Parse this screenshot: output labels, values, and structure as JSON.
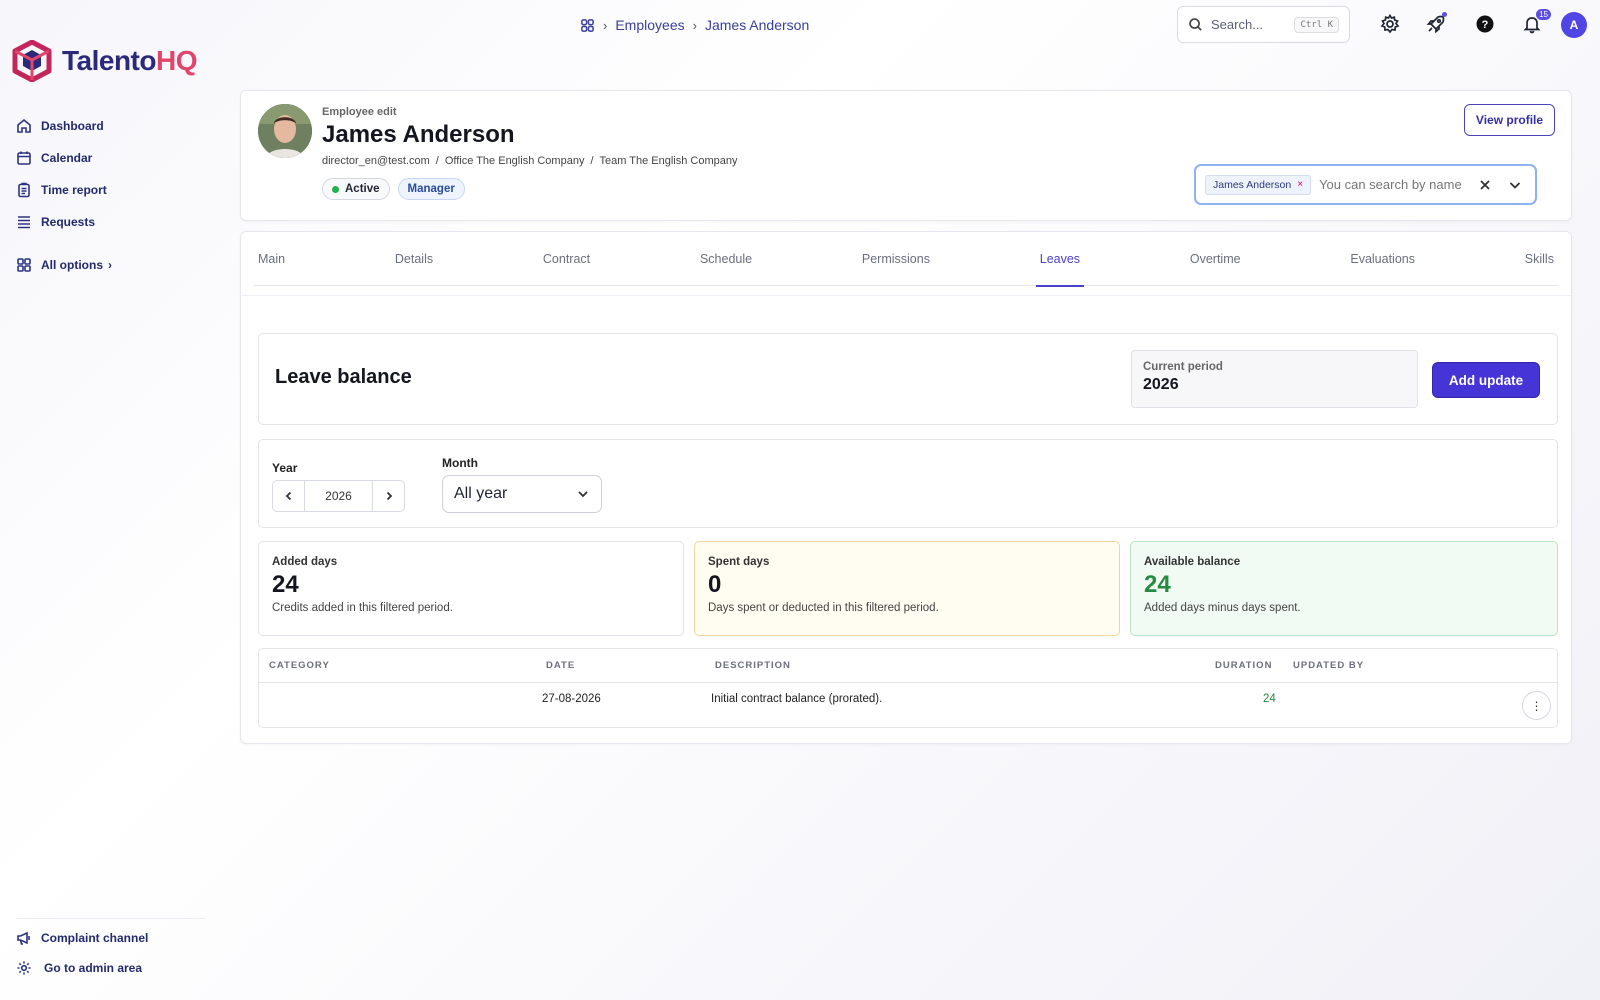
{
  "app": {
    "logo_part1": "Talento",
    "logo_part2": "HQ",
    "brand_colors": {
      "primary": "#2b2a7a",
      "accent": "#e2456b",
      "button": "#4635d6"
    }
  },
  "sidebar": {
    "items": [
      {
        "label": "Dashboard",
        "icon": "home-icon"
      },
      {
        "label": "Calendar",
        "icon": "calendar-icon"
      },
      {
        "label": "Time report",
        "icon": "clipboard-icon"
      },
      {
        "label": "Requests",
        "icon": "list-icon"
      }
    ],
    "all_options": "All options",
    "bottom": [
      {
        "label": "Complaint channel",
        "icon": "megaphone-icon"
      },
      {
        "label": "Go to admin area",
        "icon": "gear-icon"
      }
    ]
  },
  "breadcrumb": {
    "items": [
      "Employees",
      "James Anderson"
    ]
  },
  "topbar": {
    "search_placeholder": "Search...",
    "search_shortcut": "Ctrl K",
    "notification_count": "15",
    "avatar_initial": "A"
  },
  "employee": {
    "kicker": "Employee edit",
    "name": "James Anderson",
    "email": "director_en@test.com",
    "office": "Office The English Company",
    "team": "Team The English Company",
    "status": "Active",
    "role": "Manager",
    "view_profile": "View profile",
    "selector_chip": "James Anderson",
    "selector_placeholder": "You can search by name"
  },
  "tabs": [
    "Main",
    "Details",
    "Contract",
    "Schedule",
    "Permissions",
    "Leaves",
    "Overtime",
    "Evaluations",
    "Skills"
  ],
  "active_tab": "Leaves",
  "leave_balance": {
    "title": "Leave balance",
    "period_label": "Current period",
    "period_value": "2026",
    "add_button": "Add update"
  },
  "filters": {
    "year_label": "Year",
    "year_value": "2026",
    "month_label": "Month",
    "month_value": "All year"
  },
  "stats": {
    "added": {
      "label": "Added days",
      "value": "24",
      "desc": "Credits added in this filtered period."
    },
    "spent": {
      "label": "Spent days",
      "value": "0",
      "desc": "Days spent or deducted in this filtered period."
    },
    "available": {
      "label": "Available balance",
      "value": "24",
      "desc": "Added days minus days spent."
    }
  },
  "table": {
    "headers": [
      "CATEGORY",
      "DATE",
      "DESCRIPTION",
      "DURATION",
      "UPDATED BY"
    ],
    "rows": [
      {
        "category": "",
        "date": "27-08-2026",
        "description": "Initial contract balance (prorated).",
        "duration": "24",
        "updated_by": ""
      }
    ]
  }
}
